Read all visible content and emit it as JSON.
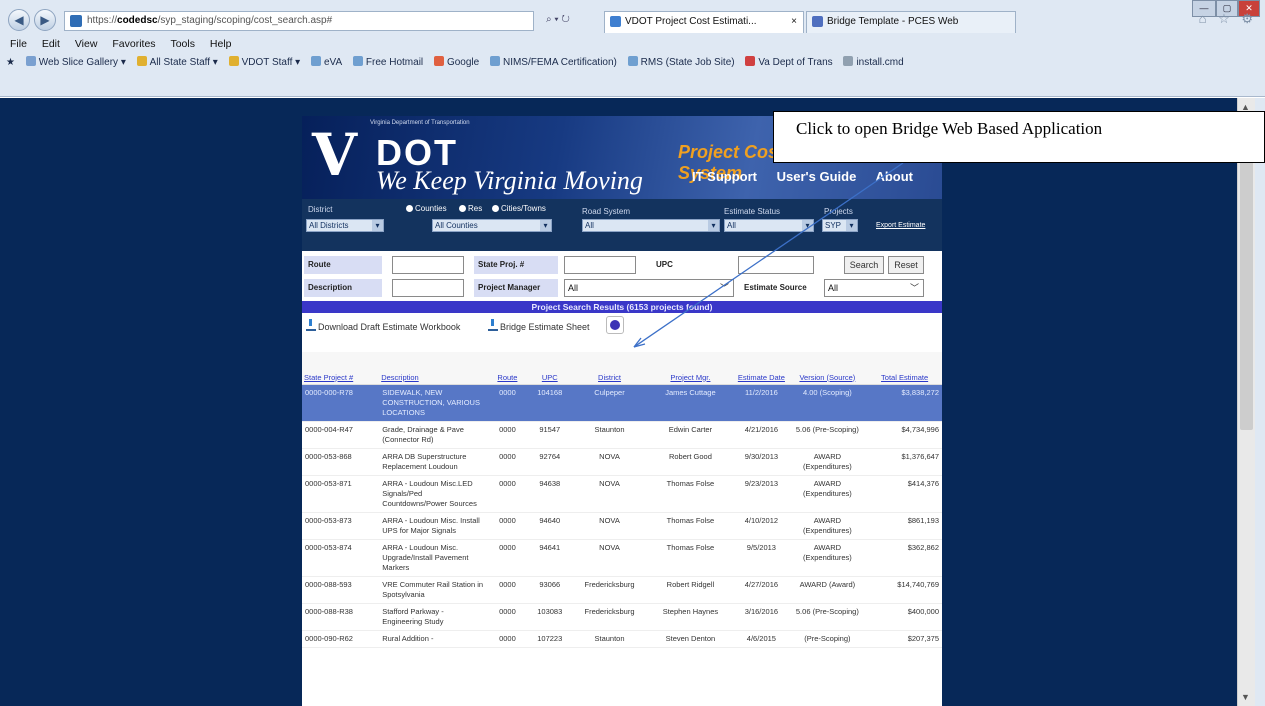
{
  "browser": {
    "url_host": "codedsc",
    "url_path": "/syp_staging/scoping/cost_search.asp#",
    "url_prefix": "https://",
    "addr_tools": "⌕ ▾ ↻",
    "tabs": [
      {
        "label": "VDOT Project Cost Estimati...",
        "close": "×",
        "icon_color": "#3f7fd0"
      },
      {
        "label": "Bridge Template - PCES Web",
        "icon_color": "#4f6fbf"
      }
    ],
    "window_buttons": [
      "—",
      "▢",
      "✕"
    ],
    "right_icons": "⌂ ☆ ⚙",
    "menu": [
      "File",
      "Edit",
      "View",
      "Favorites",
      "Tools",
      "Help"
    ],
    "favorites": [
      {
        "label": "Web Slice Gallery ▾",
        "color": "#7aa0d0"
      },
      {
        "label": "All State Staff ▾",
        "color": "#e0b030"
      },
      {
        "label": "VDOT Staff ▾",
        "color": "#e0b030"
      },
      {
        "label": "eVA",
        "color": "#6f9fd0"
      },
      {
        "label": "Free Hotmail",
        "color": "#6f9fd0"
      },
      {
        "label": "Google",
        "color": "#e06040"
      },
      {
        "label": "NIMS/FEMA Certification)",
        "color": "#6f9fd0"
      },
      {
        "label": "RMS (State Job Site)",
        "color": "#6f9fd0"
      },
      {
        "label": "Va Dept of Trans",
        "color": "#d04040"
      },
      {
        "label": "install.cmd",
        "color": "#90a0b0"
      }
    ]
  },
  "banner": {
    "dept": "Virginia Department of Transportation",
    "logo_v": "V",
    "logo_dot": "DOT",
    "tagline": "We Keep Virginia Moving",
    "title": "Project Cost Estimating System",
    "links": [
      "IT Support",
      "User's Guide",
      "About"
    ]
  },
  "filters": {
    "district_label": "District",
    "district_value": "All Districts",
    "radio_counties": "Counties",
    "radio_res": "Res",
    "radio_cities": "Cities/Towns",
    "county_value": "All Counties",
    "road_system_label": "Road System",
    "road_system_value": "All",
    "estimate_status_label": "Estimate Status",
    "estimate_status_value": "All",
    "projects_label": "Projects",
    "projects_value": "SYP",
    "export_label": "Export Estimate"
  },
  "search": {
    "route_label": "Route",
    "state_proj_label": "State Proj. #",
    "upc_label": "UPC",
    "search_button": "Search",
    "reset_button": "Reset",
    "description_label": "Description",
    "project_manager_label": "Project Manager",
    "project_manager_value": "All",
    "estimate_source_label": "Estimate Source",
    "estimate_source_value": "All"
  },
  "results": {
    "header": "Project Search Results (6153 projects found)",
    "download_draft": "Download Draft Estimate Workbook",
    "bridge_sheet": "Bridge Estimate Sheet",
    "columns": [
      "State Project #",
      "Description",
      "Route",
      "UPC",
      "District",
      "Project Mgr.",
      "Estimate Date",
      "Version (Source)",
      "Total Estimate"
    ],
    "rows": [
      [
        "0000-000-R78",
        "SIDEWALK, NEW CONSTRUCTION, VARIOUS LOCATIONS",
        "0000",
        "104168",
        "Culpeper",
        "James Cuttage",
        "11/2/2016",
        "4.00 (Scoping)",
        "$3,838,272"
      ],
      [
        "0000-004-R47",
        "Grade, Drainage & Pave (Connector Rd)",
        "0000",
        "91547",
        "Staunton",
        "Edwin Carter",
        "4/21/2016",
        "5.06 (Pre-Scoping)",
        "$4,734,996"
      ],
      [
        "0000-053-868",
        "ARRA DB Superstructure Replacement Loudoun",
        "0000",
        "92764",
        "NOVA",
        "Robert Good",
        "9/30/2013",
        "AWARD (Expenditures)",
        "$1,376,647"
      ],
      [
        "0000-053-871",
        "ARRA - Loudoun Misc.LED Signals/Ped Countdowns/Power Sources",
        "0000",
        "94638",
        "NOVA",
        "Thomas Folse",
        "9/23/2013",
        "AWARD (Expenditures)",
        "$414,376"
      ],
      [
        "0000-053-873",
        "ARRA - Loudoun Misc. Install UPS for Major Signals",
        "0000",
        "94640",
        "NOVA",
        "Thomas Folse",
        "4/10/2012",
        "AWARD (Expenditures)",
        "$861,193"
      ],
      [
        "0000-053-874",
        "ARRA - Loudoun Misc. Upgrade/Install Pavement Markers",
        "0000",
        "94641",
        "NOVA",
        "Thomas Folse",
        "9/5/2013",
        "AWARD (Expenditures)",
        "$362,862"
      ],
      [
        "0000-088-593",
        "VRE Commuter Rail Station in Spotsylvania",
        "0000",
        "93066",
        "Fredericksburg",
        "Robert Ridgell",
        "4/27/2016",
        "AWARD (Award)",
        "$14,740,769"
      ],
      [
        "0000-088-R38",
        "Stafford Parkway - Engineering Study",
        "0000",
        "103083",
        "Fredericksburg",
        "Stephen Haynes",
        "3/16/2016",
        "5.06 (Pre-Scoping)",
        "$400,000"
      ],
      [
        "0000-090-R62",
        "Rural Addition -",
        "0000",
        "107223",
        "Staunton",
        "Steven Denton",
        "4/6/2015",
        "(Pre-Scoping)",
        "$207,375"
      ]
    ]
  },
  "callout": {
    "text": "Click to open Bridge Web Based Application"
  }
}
